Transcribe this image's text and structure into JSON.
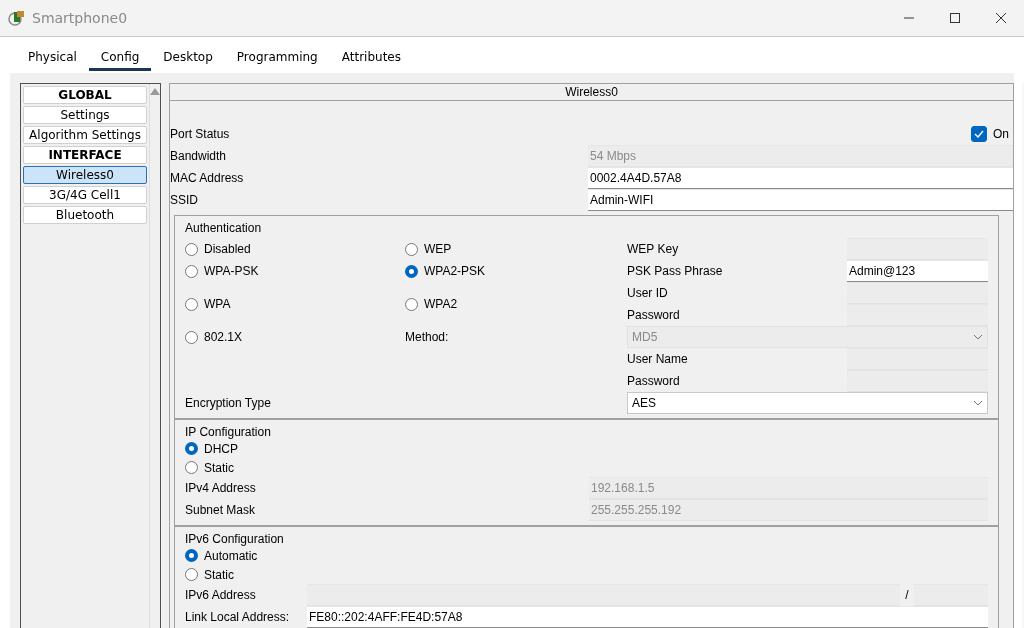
{
  "window": {
    "title": "Smartphone0"
  },
  "tabs": [
    {
      "label": "Physical",
      "selected": false
    },
    {
      "label": "Config",
      "selected": true
    },
    {
      "label": "Desktop",
      "selected": false
    },
    {
      "label": "Programming",
      "selected": false
    },
    {
      "label": "Attributes",
      "selected": false
    }
  ],
  "sidebar": {
    "items": [
      {
        "label": "GLOBAL",
        "kind": "heading",
        "selected": false
      },
      {
        "label": "Settings",
        "kind": "item",
        "selected": false
      },
      {
        "label": "Algorithm Settings",
        "kind": "item",
        "selected": false
      },
      {
        "label": "INTERFACE",
        "kind": "heading",
        "selected": false
      },
      {
        "label": "Wireless0",
        "kind": "item",
        "selected": true
      },
      {
        "label": "3G/4G Cell1",
        "kind": "item",
        "selected": false
      },
      {
        "label": "Bluetooth",
        "kind": "item",
        "selected": false
      }
    ]
  },
  "panel": {
    "title": "Wireless0",
    "port_status": {
      "label": "Port Status",
      "checked": true,
      "text": "On"
    },
    "fields": [
      {
        "label": "Bandwidth",
        "value": "54 Mbps",
        "disabled": true
      },
      {
        "label": "MAC Address",
        "value": "0002.4A4D.57A8",
        "disabled": false
      },
      {
        "label": "SSID",
        "value": "Admin-WIFI",
        "disabled": false
      }
    ],
    "authentication": {
      "title": "Authentication",
      "options": [
        {
          "label": "Disabled",
          "selected": false
        },
        {
          "label": "WEP",
          "selected": false
        },
        {
          "label": "WPA-PSK",
          "selected": false
        },
        {
          "label": "WPA2-PSK",
          "selected": true
        },
        {
          "label": "WPA",
          "selected": false
        },
        {
          "label": "WPA2",
          "selected": false
        },
        {
          "label": "802.1X",
          "selected": false
        }
      ],
      "credentials": [
        {
          "label": "WEP Key",
          "disabled": true
        },
        {
          "label": "PSK Pass Phrase",
          "value": "Admin@123",
          "disabled": false
        },
        {
          "label": "User ID",
          "disabled": true
        },
        {
          "label": "Password",
          "disabled": true
        },
        {
          "label": "User Name",
          "disabled": true
        },
        {
          "label": "Password",
          "disabled": true
        }
      ],
      "method": {
        "label": "Method:",
        "value": "MD5",
        "disabled": true
      },
      "encryption": {
        "label": "Encryption Type",
        "value": "AES",
        "disabled": false
      }
    },
    "ip_configuration": {
      "title": "IP Configuration",
      "modes": [
        {
          "label": "DHCP",
          "selected": true
        },
        {
          "label": "Static",
          "selected": false
        }
      ],
      "fields": [
        {
          "label": "IPv4 Address",
          "value": "192.168.1.5",
          "disabled": true
        },
        {
          "label": "Subnet Mask",
          "value": "255.255.255.192",
          "disabled": true
        }
      ]
    },
    "ipv6_configuration": {
      "title": "IPv6 Configuration",
      "modes": [
        {
          "label": "Automatic",
          "selected": true
        },
        {
          "label": "Static",
          "selected": false
        }
      ],
      "address": {
        "label": "IPv6 Address",
        "separator": "/",
        "disabled": true
      },
      "link_local": {
        "label": "Link Local Address:",
        "value": "FE80::202:4AFF:FE4D:57A8",
        "disabled": false
      }
    }
  }
}
